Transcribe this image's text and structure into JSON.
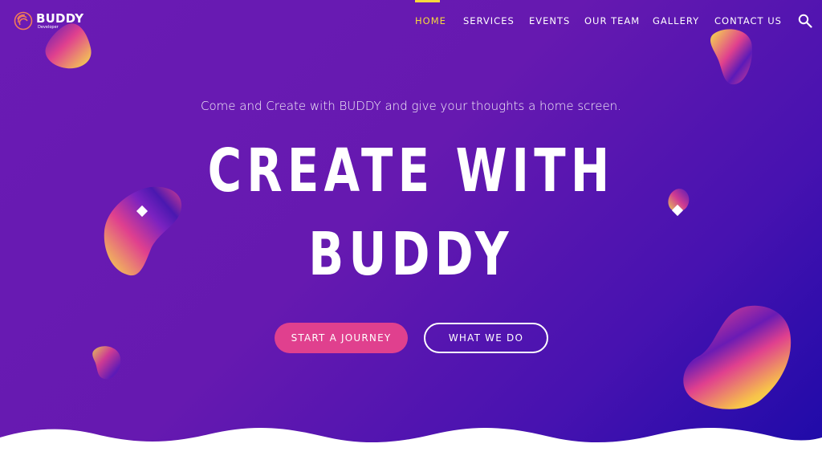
{
  "brand": {
    "name": "BUDDY",
    "subtitle": "Developer",
    "accent": "#f6d93c",
    "pink": "#e0408e"
  },
  "nav": {
    "items": [
      {
        "label": "HOME",
        "active": true
      },
      {
        "label": "SERVICES",
        "active": false
      },
      {
        "label": "EVENTS",
        "active": false
      },
      {
        "label": "OUR TEAM",
        "active": false
      },
      {
        "label": "GALLERY",
        "active": false
      },
      {
        "label": "CONTACT US",
        "active": false
      }
    ],
    "search_icon": "search-icon"
  },
  "hero": {
    "tagline": "Come and Create with BUDDY and give your thoughts a home screen.",
    "headline_line1": "CREATE WITH",
    "headline_line2": "BUDDY",
    "primary_button": "START A JOURNEY",
    "secondary_button": "WHAT WE DO"
  }
}
